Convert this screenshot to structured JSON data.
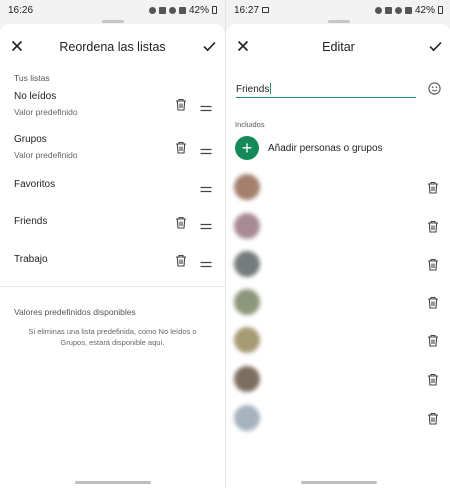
{
  "left": {
    "status": {
      "time": "16:26",
      "battery": "42%"
    },
    "title": "Reordena las listas",
    "section_label": "Tus listas",
    "lists": [
      {
        "name": "No leídos",
        "sub": "Valor predefinido",
        "deletable": true
      },
      {
        "name": "Grupos",
        "sub": "Valor predefinido",
        "deletable": true
      },
      {
        "name": "Favoritos",
        "sub": "",
        "deletable": false
      },
      {
        "name": "Friends",
        "sub": "",
        "deletable": true
      },
      {
        "name": "Trabajo",
        "sub": "",
        "deletable": true
      }
    ],
    "available_label": "Valores predefinidos disponibles",
    "available_note": "Si eliminas una lista predefinida, como No leídos o Grupos, estará disponible aquí."
  },
  "right": {
    "status": {
      "time": "16:27",
      "battery": "42%"
    },
    "title": "Editar",
    "name_value": "Friends",
    "included_label": "Incluidos",
    "add_label": "Añadir personas o grupos",
    "members": [
      {
        "avatar_color": "#a37f6c"
      },
      {
        "avatar_color": "#a88a93"
      },
      {
        "avatar_color": "#747b7b"
      },
      {
        "avatar_color": "#8c977b"
      },
      {
        "avatar_color": "#a69b73"
      },
      {
        "avatar_color": "#7d6e62"
      },
      {
        "avatar_color": "#a6b2bd"
      }
    ]
  },
  "colors": {
    "accent": "#138a58",
    "field_underline": "#1e8e5a"
  }
}
